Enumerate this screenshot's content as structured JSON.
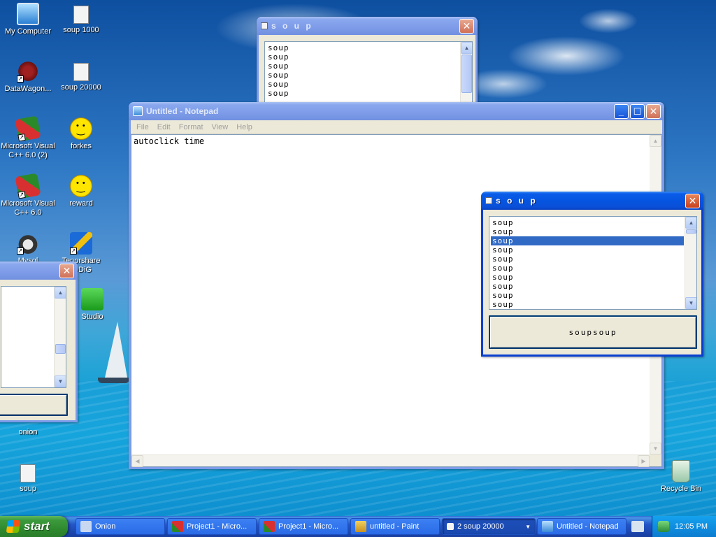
{
  "desktop": {
    "icons": [
      {
        "label": "My Computer"
      },
      {
        "label": "soup 1000"
      },
      {
        "label": "DataWagon..."
      },
      {
        "label": "soup 20000"
      },
      {
        "label": "Microsoft Visual C++ 6.0 (2)"
      },
      {
        "label": "forkes"
      },
      {
        "label": "Microsoft Visual C++ 6.0"
      },
      {
        "label": "reward"
      },
      {
        "label": "Mysql"
      },
      {
        "label": "Tenorshare iODiG"
      },
      {
        "label": "Studio"
      },
      {
        "label": "onion"
      },
      {
        "label": "soup"
      },
      {
        "label": "Recycle Bin"
      }
    ]
  },
  "soup_window_back": {
    "title": "s o u p",
    "items": [
      "soup",
      "soup",
      "soup",
      "soup",
      "soup",
      "soup"
    ]
  },
  "notepad": {
    "title": "Untitled - Notepad",
    "menu": [
      "File",
      "Edit",
      "Format",
      "View",
      "Help"
    ],
    "content": "autoclick time"
  },
  "soup_window_front": {
    "title": "s o u p",
    "items": [
      "soup",
      "soup",
      "soup",
      "soup",
      "soup",
      "soup",
      "soup",
      "soup",
      "soup",
      "soup"
    ],
    "selected_index": 2,
    "button_label": "soupsoup"
  },
  "taskbar": {
    "start_label": "start",
    "tasks": [
      {
        "label": "Onion"
      },
      {
        "label": "Project1 - Micro..."
      },
      {
        "label": "Project1 - Micro..."
      },
      {
        "label": "untitled - Paint"
      },
      {
        "label": "2 soup 20000"
      },
      {
        "label": "Untitled - Notepad"
      }
    ],
    "clock": "12:05 PM"
  }
}
